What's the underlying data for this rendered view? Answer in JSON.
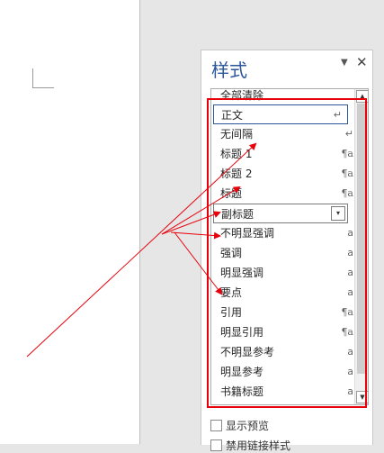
{
  "pane": {
    "title": "样式",
    "menu_glyph": "▼",
    "close_glyph": "✕"
  },
  "styles": [
    {
      "label": "全部清除",
      "mark": ""
    },
    {
      "label": "正文",
      "mark": "↵",
      "state": "selected"
    },
    {
      "label": "无间隔",
      "mark": "↵"
    },
    {
      "label": "标题 1",
      "mark": "¶a"
    },
    {
      "label": "标题 2",
      "mark": "¶a"
    },
    {
      "label": "标题",
      "mark": "¶a"
    },
    {
      "label": "副标题",
      "mark": "▾",
      "state": "hover"
    },
    {
      "label": "不明显强调",
      "mark": "a"
    },
    {
      "label": "强调",
      "mark": "a"
    },
    {
      "label": "明显强调",
      "mark": "a"
    },
    {
      "label": "要点",
      "mark": "a"
    },
    {
      "label": "引用",
      "mark": "¶a"
    },
    {
      "label": "明显引用",
      "mark": "¶a"
    },
    {
      "label": "不明显参考",
      "mark": "a"
    },
    {
      "label": "明显参考",
      "mark": "a"
    },
    {
      "label": "书籍标题",
      "mark": "a"
    }
  ],
  "options": {
    "show_preview": "显示预览",
    "disable_linked": "禁用链接样式"
  },
  "scroll": {
    "up_glyph": "▲",
    "down_glyph": "▼"
  },
  "colors": {
    "accent": "#2b579a",
    "annotation": "#e8000b"
  }
}
